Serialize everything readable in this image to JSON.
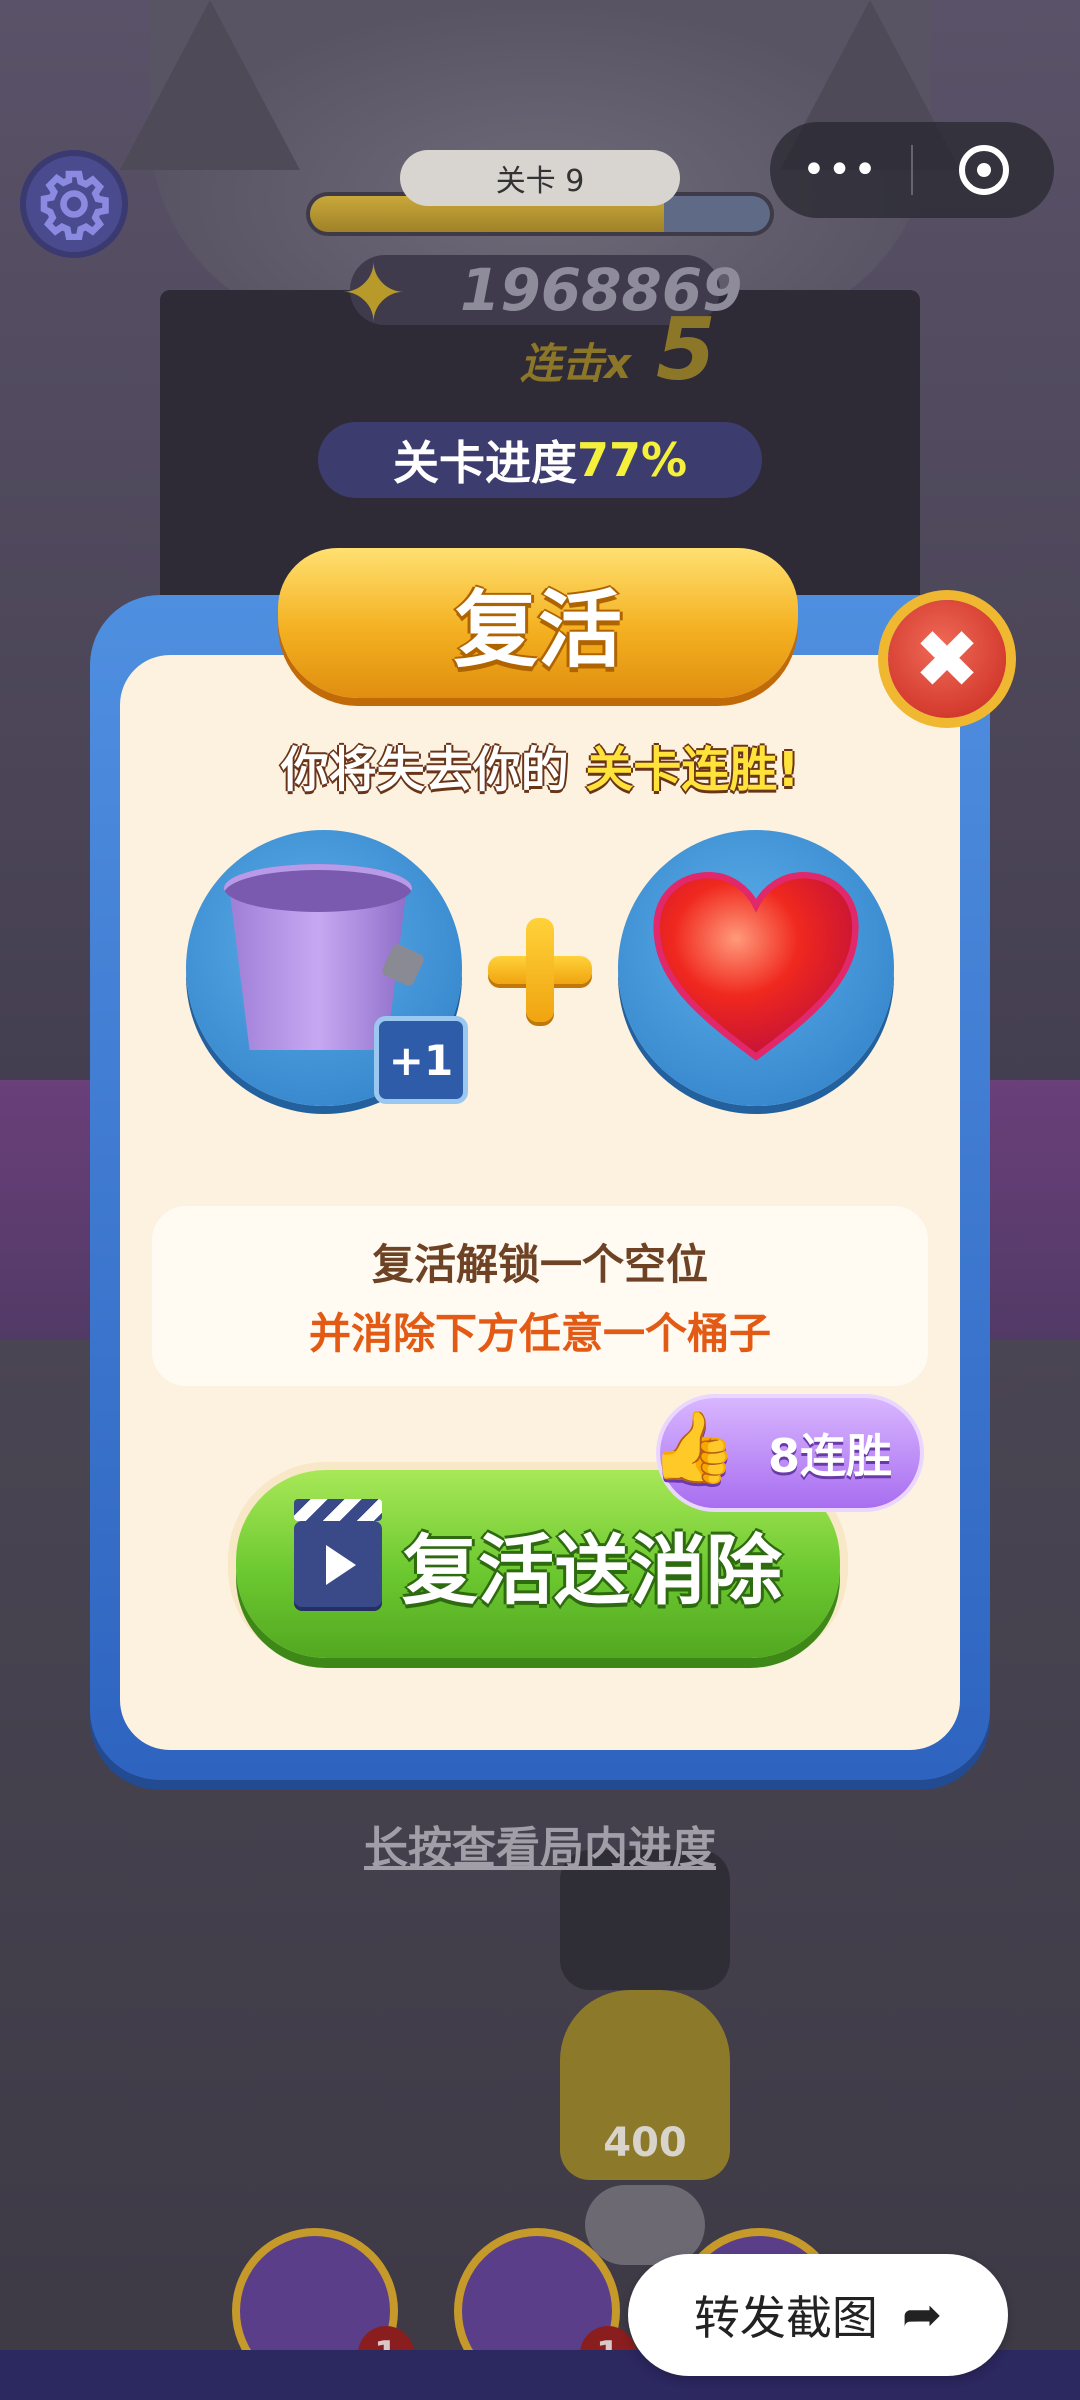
{
  "hud": {
    "level_label": "关卡 9",
    "level_progress_fraction": 0.77,
    "score": "1968869",
    "combo_label": "连击x",
    "combo_value": "5",
    "stage_progress_label": "关卡进度",
    "stage_progress_value": "77%",
    "capsule_more_icon": "more-dots-icon",
    "capsule_close_icon": "target-icon",
    "settings_icon": "gear-icon"
  },
  "dialog": {
    "title": "复活",
    "warning_prefix": "你将失去你的 ",
    "warning_highlight": "关卡连胜!",
    "reward_badge": "+1",
    "info_line_1": "复活解锁一个空位",
    "info_line_2": "并消除下方任意一个桶子",
    "revive_button_label": "复活送消除",
    "streak_badge": "8连胜",
    "close_icon": "close-icon"
  },
  "playfield": {
    "long_press_hint": "长按查看局内进度",
    "bucket_count": "400",
    "tool_counts": [
      "1",
      "1"
    ]
  },
  "share": {
    "label": "转发截图",
    "icon": "share-arrow-icon"
  },
  "colors": {
    "dialog_border": "#2e64c0",
    "dialog_bg": "#fdf2e0",
    "banner": "#f4b020",
    "revive_button": "#6cc830",
    "highlight_yellow": "#f4f03c",
    "info_orange": "#e25a14"
  }
}
